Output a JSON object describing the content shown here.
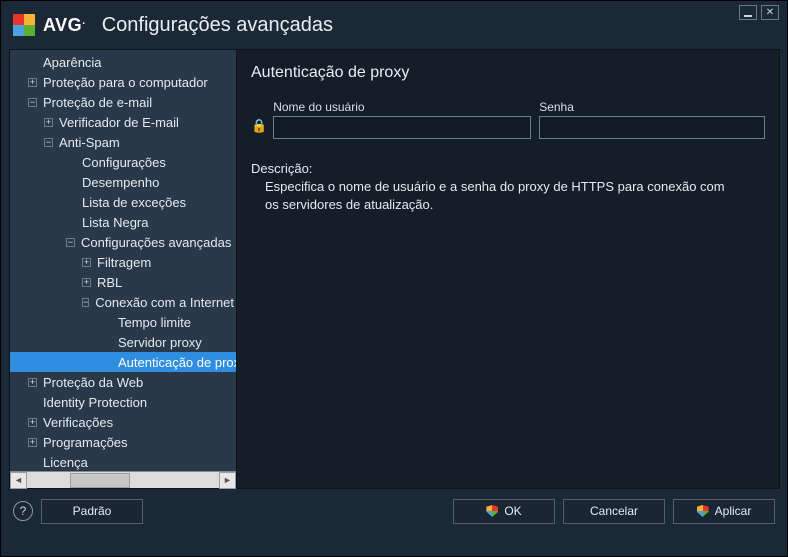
{
  "window": {
    "title": "Configurações avançadas"
  },
  "logo": {
    "text": "AVG"
  },
  "tree": {
    "aparencia": "Aparência",
    "protecao_computador": "Proteção para o computador",
    "protecao_email": "Proteção de e-mail",
    "verificador_email": "Verificador de E-mail",
    "anti_spam": "Anti-Spam",
    "configuracoes": "Configurações",
    "desempenho": "Desempenho",
    "lista_excecoes": "Lista de exceções",
    "lista_negra": "Lista Negra",
    "config_avancadas": "Configurações avançadas",
    "filtragem": "Filtragem",
    "rbl": "RBL",
    "conexao_internet": "Conexão com a Internet",
    "tempo_limite": "Tempo limite",
    "servidor_proxy": "Servidor proxy",
    "autenticacao_proxy": "Autenticação de proxy",
    "protecao_web": "Proteção da Web",
    "identity_protection": "Identity Protection",
    "verificacoes": "Verificações",
    "programacoes": "Programações",
    "licenca": "Licença"
  },
  "panel": {
    "title": "Autenticação de proxy",
    "user_label": "Nome do usuário",
    "pass_label": "Senha",
    "user_value": "",
    "pass_value": "",
    "desc_heading": "Descrição:",
    "desc_body": "Especifica o nome de usuário e a senha do proxy de HTTPS para conexão com os servidores de atualização."
  },
  "footer": {
    "padrao": "Padrão",
    "ok": "OK",
    "cancelar": "Cancelar",
    "aplicar": "Aplicar"
  }
}
